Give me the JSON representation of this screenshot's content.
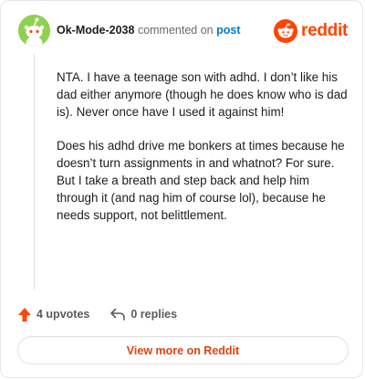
{
  "comment": {
    "username": "Ok-Mode-2038",
    "action_text": "commented on",
    "post_link": "post",
    "paragraphs": [
      "NTA. I have a teenage son with adhd. I don’t like his dad either anymore (though he does know who is dad is). Never once have I used it against him!",
      "Does his adhd drive me bonkers at times because he doesn’t turn assignments in and whatnot? For sure. But I take a breath and step back and help him through it (and nag him of course lol), because he needs support, not belittlement."
    ],
    "avatar_color": "#8fd14f"
  },
  "brand": {
    "name": "reddit",
    "icon": "reddit-snoo-icon",
    "color": "#ff4500"
  },
  "actions": {
    "upvotes_label": "4 upvotes",
    "upvote_icon": "upvote-arrow-icon",
    "upvote_color": "#ff4500",
    "replies_label": "0 replies",
    "reply_icon": "reply-arrow-icon"
  },
  "footer": {
    "view_more_label": "View more on Reddit",
    "accent": "#e0420c"
  }
}
